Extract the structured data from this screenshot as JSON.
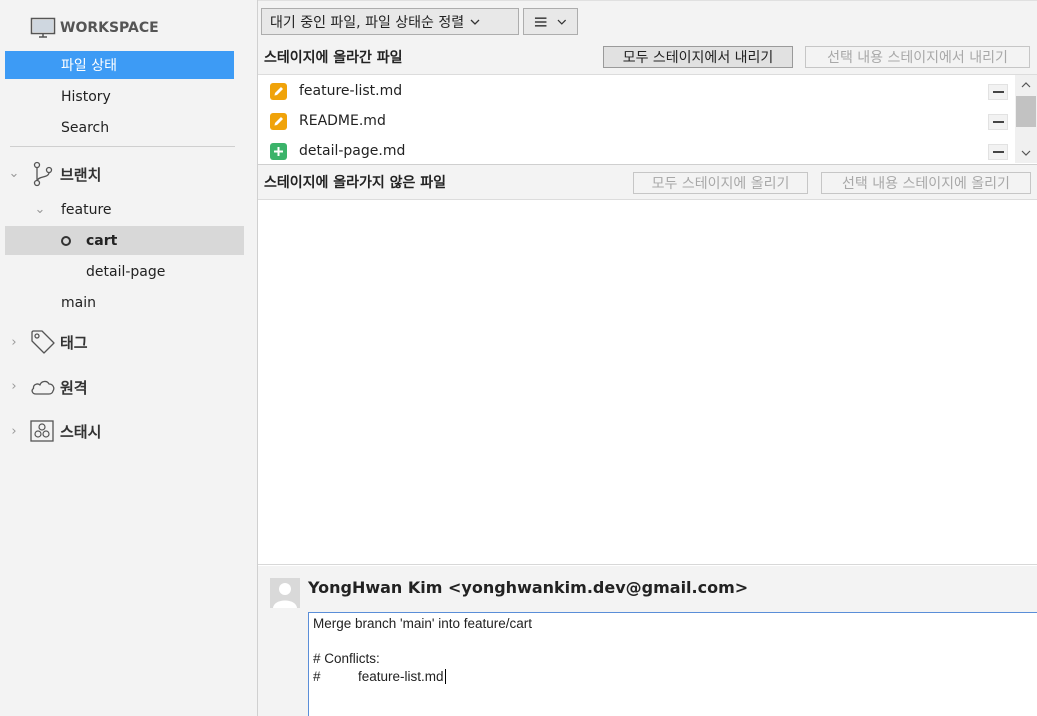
{
  "sidebar": {
    "workspace": "WORKSPACE",
    "items": [
      {
        "label": "파일 상태"
      },
      {
        "label": "History"
      },
      {
        "label": "Search"
      }
    ],
    "branches": {
      "label": "브랜치",
      "feature": "feature",
      "cart": "cart",
      "detail_page": "detail-page",
      "main": "main"
    },
    "tags": "태그",
    "remotes": "원격",
    "stashes": "스태시"
  },
  "toolbar": {
    "view_dropdown": "대기 중인 파일, 파일 상태순 정렬",
    "list_dropdown_icon": "list-icon"
  },
  "staged": {
    "title": "스테이지에 올라간 파일",
    "unstage_all": "모두 스테이지에서 내리기",
    "unstage_selected": "선택 내용 스테이지에서 내리기",
    "files": [
      {
        "name": "feature-list.md",
        "status": "modified",
        "color": "#f0a30a"
      },
      {
        "name": "README.md",
        "status": "modified",
        "color": "#f0a30a"
      },
      {
        "name": "detail-page.md",
        "status": "added",
        "color": "#3bb36a"
      }
    ]
  },
  "unstaged": {
    "title": "스테이지에 올라가지 않은 파일",
    "stage_all": "모두 스테이지에 올리기",
    "stage_selected": "선택 내용 스테이지에 올리기"
  },
  "commit": {
    "author": "YongHwan Kim <yonghwankim.dev@gmail.com>",
    "message_lines": [
      "Merge branch 'main' into feature/cart",
      "",
      "# Conflicts:",
      "#\t    feature-list.md"
    ]
  },
  "colors": {
    "selected": "#3d9bf5",
    "modified": "#f0a30a",
    "added": "#3bb36a"
  }
}
